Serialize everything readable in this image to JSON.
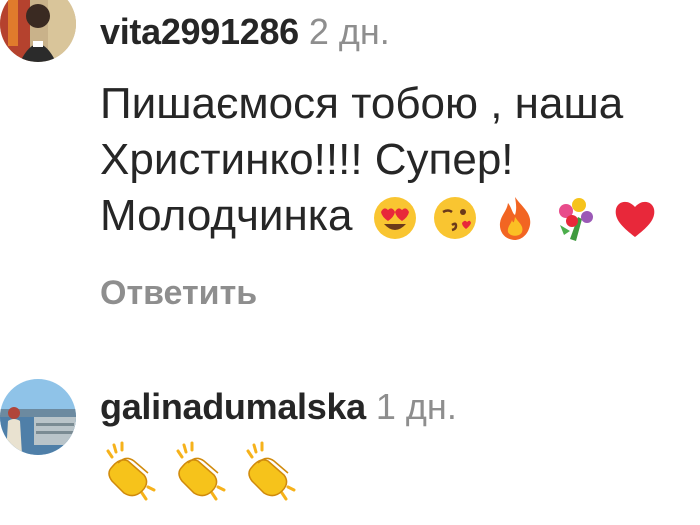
{
  "comments": [
    {
      "username": "vita2991286",
      "time": "2 дн.",
      "text_lines": [
        "Пишаємося тобою , наша",
        "Христинко!!!! Супер!",
        "Молодчинка"
      ],
      "emojis": [
        "heart-eyes-emoji",
        "kiss-wink-emoji",
        "fire-emoji",
        "bouquet-emoji",
        "red-heart-emoji"
      ],
      "reply_label": "Ответить"
    },
    {
      "username": "galinadumalska",
      "time": "1 дн.",
      "emojis": [
        "clapping-hands-emoji",
        "clapping-hands-emoji",
        "clapping-hands-emoji"
      ]
    }
  ]
}
